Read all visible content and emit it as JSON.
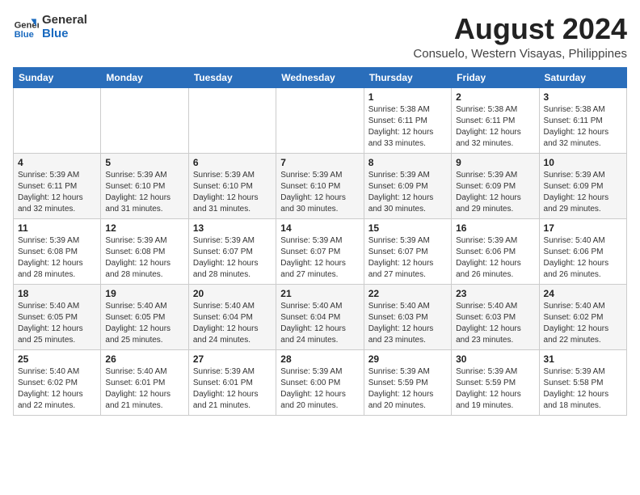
{
  "logo": {
    "text_general": "General",
    "text_blue": "Blue"
  },
  "header": {
    "title": "August 2024",
    "subtitle": "Consuelo, Western Visayas, Philippines"
  },
  "weekdays": [
    "Sunday",
    "Monday",
    "Tuesday",
    "Wednesday",
    "Thursday",
    "Friday",
    "Saturday"
  ],
  "weeks": [
    [
      {
        "day": "",
        "info": ""
      },
      {
        "day": "",
        "info": ""
      },
      {
        "day": "",
        "info": ""
      },
      {
        "day": "",
        "info": ""
      },
      {
        "day": "1",
        "info": "Sunrise: 5:38 AM\nSunset: 6:11 PM\nDaylight: 12 hours\nand 33 minutes."
      },
      {
        "day": "2",
        "info": "Sunrise: 5:38 AM\nSunset: 6:11 PM\nDaylight: 12 hours\nand 32 minutes."
      },
      {
        "day": "3",
        "info": "Sunrise: 5:38 AM\nSunset: 6:11 PM\nDaylight: 12 hours\nand 32 minutes."
      }
    ],
    [
      {
        "day": "4",
        "info": "Sunrise: 5:39 AM\nSunset: 6:11 PM\nDaylight: 12 hours\nand 32 minutes."
      },
      {
        "day": "5",
        "info": "Sunrise: 5:39 AM\nSunset: 6:10 PM\nDaylight: 12 hours\nand 31 minutes."
      },
      {
        "day": "6",
        "info": "Sunrise: 5:39 AM\nSunset: 6:10 PM\nDaylight: 12 hours\nand 31 minutes."
      },
      {
        "day": "7",
        "info": "Sunrise: 5:39 AM\nSunset: 6:10 PM\nDaylight: 12 hours\nand 30 minutes."
      },
      {
        "day": "8",
        "info": "Sunrise: 5:39 AM\nSunset: 6:09 PM\nDaylight: 12 hours\nand 30 minutes."
      },
      {
        "day": "9",
        "info": "Sunrise: 5:39 AM\nSunset: 6:09 PM\nDaylight: 12 hours\nand 29 minutes."
      },
      {
        "day": "10",
        "info": "Sunrise: 5:39 AM\nSunset: 6:09 PM\nDaylight: 12 hours\nand 29 minutes."
      }
    ],
    [
      {
        "day": "11",
        "info": "Sunrise: 5:39 AM\nSunset: 6:08 PM\nDaylight: 12 hours\nand 28 minutes."
      },
      {
        "day": "12",
        "info": "Sunrise: 5:39 AM\nSunset: 6:08 PM\nDaylight: 12 hours\nand 28 minutes."
      },
      {
        "day": "13",
        "info": "Sunrise: 5:39 AM\nSunset: 6:07 PM\nDaylight: 12 hours\nand 28 minutes."
      },
      {
        "day": "14",
        "info": "Sunrise: 5:39 AM\nSunset: 6:07 PM\nDaylight: 12 hours\nand 27 minutes."
      },
      {
        "day": "15",
        "info": "Sunrise: 5:39 AM\nSunset: 6:07 PM\nDaylight: 12 hours\nand 27 minutes."
      },
      {
        "day": "16",
        "info": "Sunrise: 5:39 AM\nSunset: 6:06 PM\nDaylight: 12 hours\nand 26 minutes."
      },
      {
        "day": "17",
        "info": "Sunrise: 5:40 AM\nSunset: 6:06 PM\nDaylight: 12 hours\nand 26 minutes."
      }
    ],
    [
      {
        "day": "18",
        "info": "Sunrise: 5:40 AM\nSunset: 6:05 PM\nDaylight: 12 hours\nand 25 minutes."
      },
      {
        "day": "19",
        "info": "Sunrise: 5:40 AM\nSunset: 6:05 PM\nDaylight: 12 hours\nand 25 minutes."
      },
      {
        "day": "20",
        "info": "Sunrise: 5:40 AM\nSunset: 6:04 PM\nDaylight: 12 hours\nand 24 minutes."
      },
      {
        "day": "21",
        "info": "Sunrise: 5:40 AM\nSunset: 6:04 PM\nDaylight: 12 hours\nand 24 minutes."
      },
      {
        "day": "22",
        "info": "Sunrise: 5:40 AM\nSunset: 6:03 PM\nDaylight: 12 hours\nand 23 minutes."
      },
      {
        "day": "23",
        "info": "Sunrise: 5:40 AM\nSunset: 6:03 PM\nDaylight: 12 hours\nand 23 minutes."
      },
      {
        "day": "24",
        "info": "Sunrise: 5:40 AM\nSunset: 6:02 PM\nDaylight: 12 hours\nand 22 minutes."
      }
    ],
    [
      {
        "day": "25",
        "info": "Sunrise: 5:40 AM\nSunset: 6:02 PM\nDaylight: 12 hours\nand 22 minutes."
      },
      {
        "day": "26",
        "info": "Sunrise: 5:40 AM\nSunset: 6:01 PM\nDaylight: 12 hours\nand 21 minutes."
      },
      {
        "day": "27",
        "info": "Sunrise: 5:39 AM\nSunset: 6:01 PM\nDaylight: 12 hours\nand 21 minutes."
      },
      {
        "day": "28",
        "info": "Sunrise: 5:39 AM\nSunset: 6:00 PM\nDaylight: 12 hours\nand 20 minutes."
      },
      {
        "day": "29",
        "info": "Sunrise: 5:39 AM\nSunset: 5:59 PM\nDaylight: 12 hours\nand 20 minutes."
      },
      {
        "day": "30",
        "info": "Sunrise: 5:39 AM\nSunset: 5:59 PM\nDaylight: 12 hours\nand 19 minutes."
      },
      {
        "day": "31",
        "info": "Sunrise: 5:39 AM\nSunset: 5:58 PM\nDaylight: 12 hours\nand 18 minutes."
      }
    ]
  ]
}
